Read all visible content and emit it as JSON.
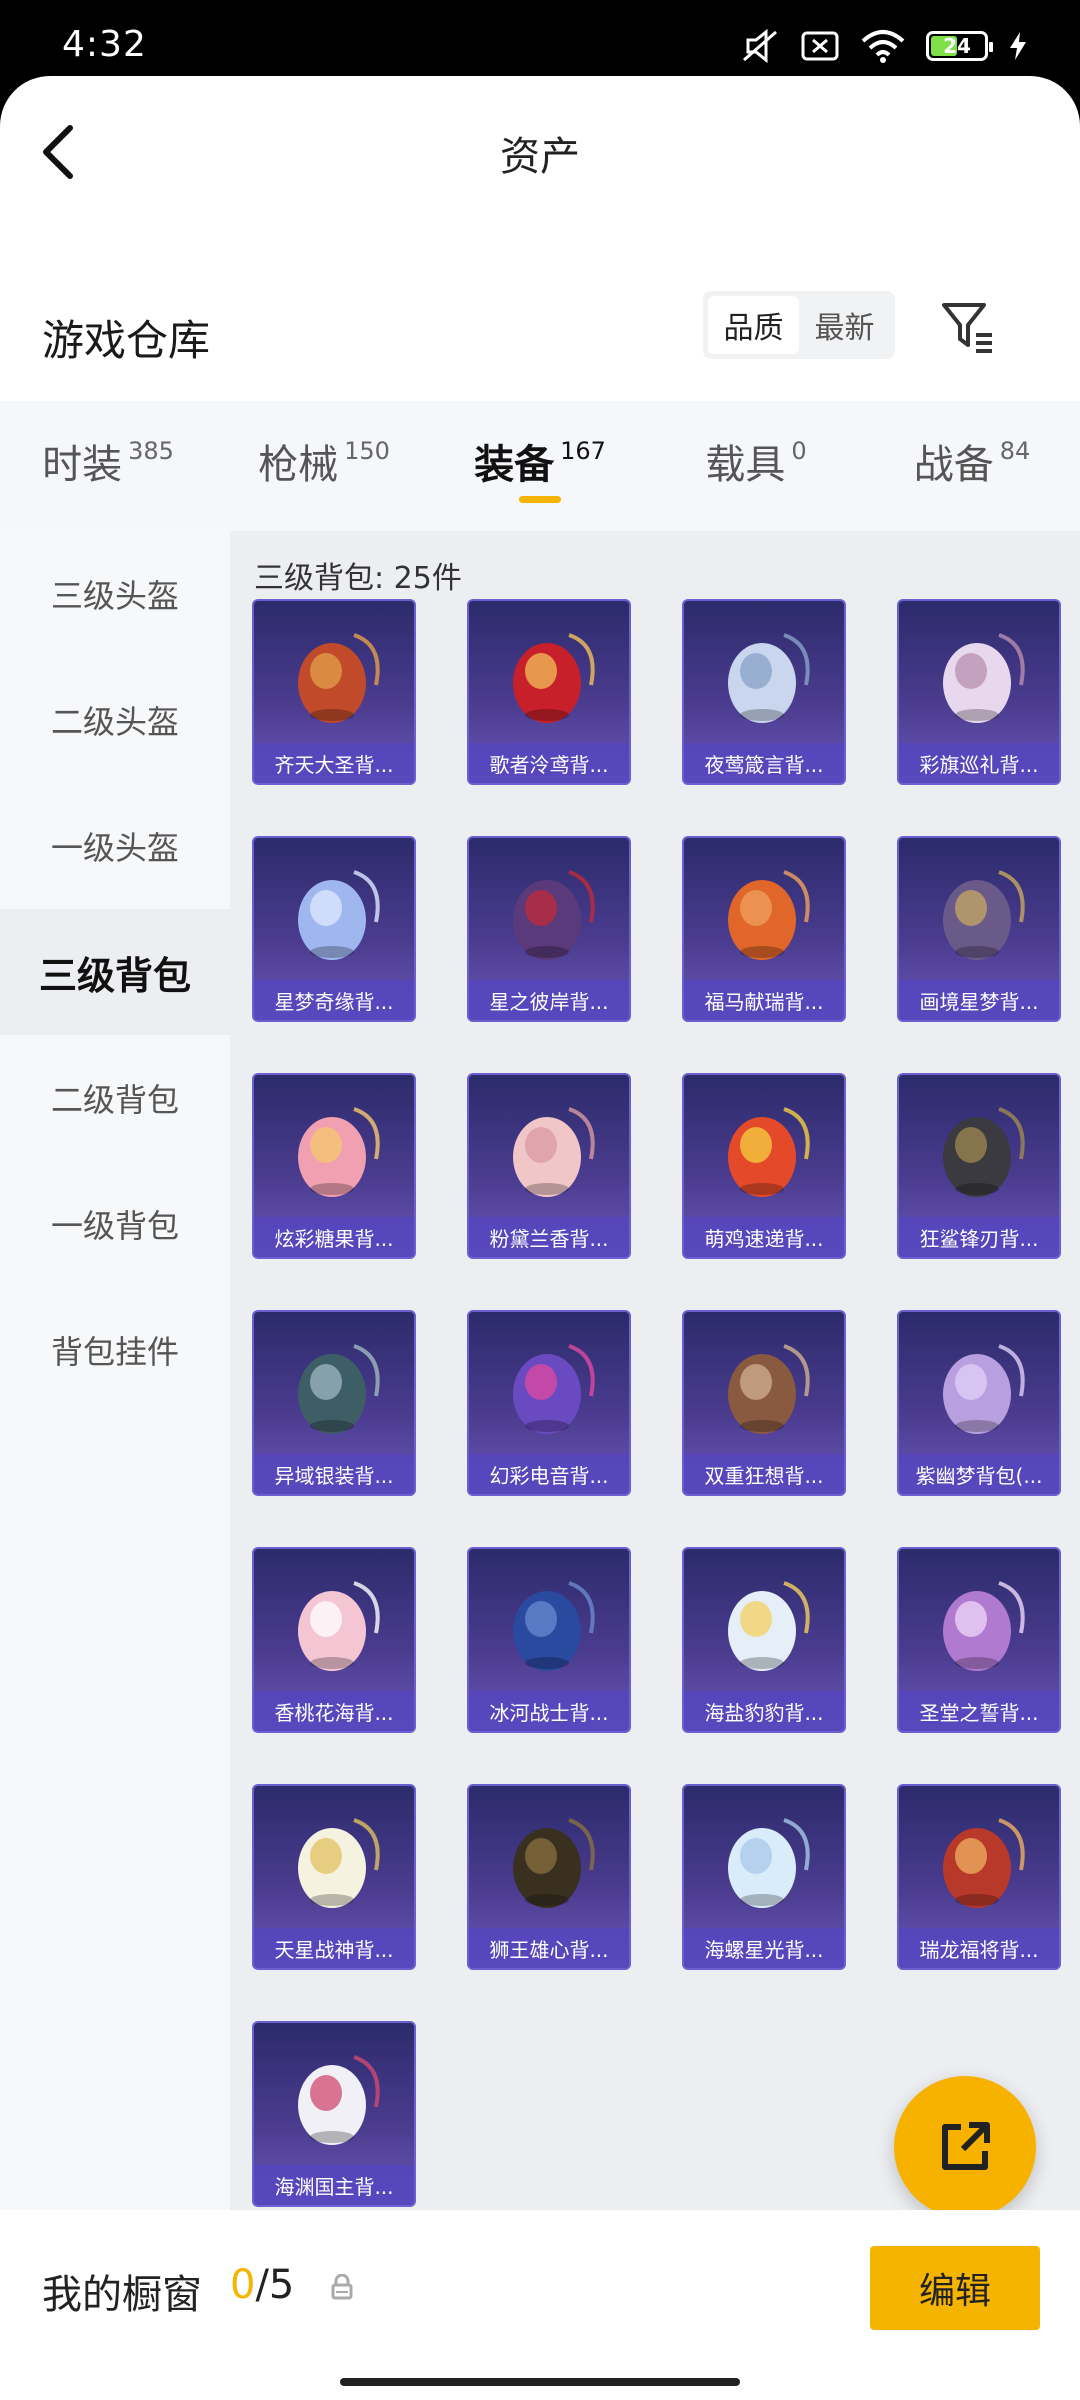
{
  "status_bar": {
    "time": "4:32",
    "battery": "24"
  },
  "header": {
    "title": "资产"
  },
  "warehouse": {
    "title": "游戏仓库",
    "sort_options": [
      "品质",
      "最新"
    ],
    "sort_active": "品质"
  },
  "tabs": [
    {
      "label": "时装",
      "count": "385"
    },
    {
      "label": "枪械",
      "count": "150"
    },
    {
      "label": "装备",
      "count": "167",
      "active": true
    },
    {
      "label": "载具",
      "count": "0"
    },
    {
      "label": "战备",
      "count": "84"
    }
  ],
  "sidebar": {
    "items": [
      {
        "label": "三级头盔"
      },
      {
        "label": "二级头盔"
      },
      {
        "label": "一级头盔"
      },
      {
        "label": "三级背包",
        "active": true
      },
      {
        "label": "二级背包"
      },
      {
        "label": "一级背包"
      },
      {
        "label": "背包挂件"
      }
    ]
  },
  "content": {
    "section_label": "三级背包: 25件",
    "items": [
      {
        "name": "齐天大圣背...",
        "icon": "monkey-king-backpack"
      },
      {
        "name": "歌者泠鸢背...",
        "icon": "singer-bag-backpack"
      },
      {
        "name": "夜莺箴言背...",
        "icon": "nightingale-backpack"
      },
      {
        "name": "彩旗巡礼背...",
        "icon": "flag-parade-backpack"
      },
      {
        "name": "星梦奇缘背...",
        "icon": "swan-backpack"
      },
      {
        "name": "星之彼岸背...",
        "icon": "star-shore-backpack"
      },
      {
        "name": "福马献瑞背...",
        "icon": "lucky-horse-backpack"
      },
      {
        "name": "画境星梦背...",
        "icon": "painting-frame-backpack"
      },
      {
        "name": "炫彩糖果背...",
        "icon": "candy-backpack"
      },
      {
        "name": "粉黛兰香背...",
        "icon": "pink-orchid-backpack"
      },
      {
        "name": "萌鸡速递背...",
        "icon": "chick-backpack"
      },
      {
        "name": "狂鲨锋刃背...",
        "icon": "shark-backpack"
      },
      {
        "name": "异域银装背...",
        "icon": "silver-tactical-backpack"
      },
      {
        "name": "幻彩电音背...",
        "icon": "electro-backpack"
      },
      {
        "name": "双重狂想背...",
        "icon": "fantasy-pony-backpack"
      },
      {
        "name": "紫幽梦背包(...",
        "icon": "purple-dream-backpack"
      },
      {
        "name": "香桃花海背...",
        "icon": "peach-blossom-backpack"
      },
      {
        "name": "冰河战士背...",
        "icon": "glacier-backpack"
      },
      {
        "name": "海盐豹豹背...",
        "icon": "sea-salt-leopard-backpack"
      },
      {
        "name": "圣堂之誓背...",
        "icon": "sacred-oath-backpack"
      },
      {
        "name": "天星战神背...",
        "icon": "star-warrior-backpack"
      },
      {
        "name": "狮王雄心背...",
        "icon": "lion-king-backpack"
      },
      {
        "name": "海螺星光背...",
        "icon": "conch-backpack"
      },
      {
        "name": "瑞龙福将背...",
        "icon": "dragon-backpack"
      },
      {
        "name": "海渊国主背...",
        "icon": "abyss-lord-backpack"
      }
    ]
  },
  "bottom_bar": {
    "showcase_label": "我的橱窗",
    "showcase_current": "0",
    "showcase_total": "/5",
    "edit_label": "编辑"
  },
  "colors": {
    "accent": "#f5b400",
    "card_bg": "#3b2f86",
    "card_label_bg": "#5646be"
  }
}
